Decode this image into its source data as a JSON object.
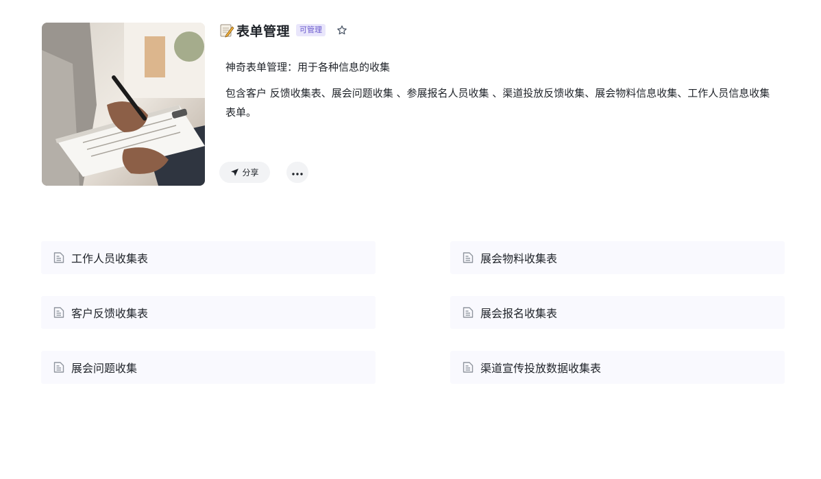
{
  "header": {
    "emoji_icon": "memo-icon",
    "title": "表单管理",
    "badge": "可管理",
    "star_icon": "star-outline-icon",
    "cover_image": "hand-writing-on-clipboard-photo"
  },
  "description": {
    "line1": "神奇表单管理：用于各种信息的收集",
    "line2": "包含客户 反馈收集表、展会问题收集 、参展报名人员收集 、渠道投放反馈收集、展会物料信息收集、工作人员信息收集 表单。"
  },
  "actions": {
    "share_label": "分享",
    "share_icon": "send-icon",
    "more_icon": "more-horizontal-icon"
  },
  "forms": {
    "left": [
      {
        "label": "工作人员收集表",
        "icon": "form-doc-icon"
      },
      {
        "label": "客户反馈收集表",
        "icon": "form-doc-icon"
      },
      {
        "label": "展会问题收集",
        "icon": "form-doc-icon"
      }
    ],
    "right": [
      {
        "label": "展会物料收集表",
        "icon": "form-doc-icon"
      },
      {
        "label": "展会报名收集表",
        "icon": "form-doc-icon"
      },
      {
        "label": "渠道宣传投放数据收集表",
        "icon": "form-doc-icon"
      }
    ]
  },
  "colors": {
    "badge_bg": "#e9e6fb",
    "badge_text": "#6a5acd",
    "item_bg": "#f9f9fe",
    "button_bg": "#f2f3f5"
  }
}
